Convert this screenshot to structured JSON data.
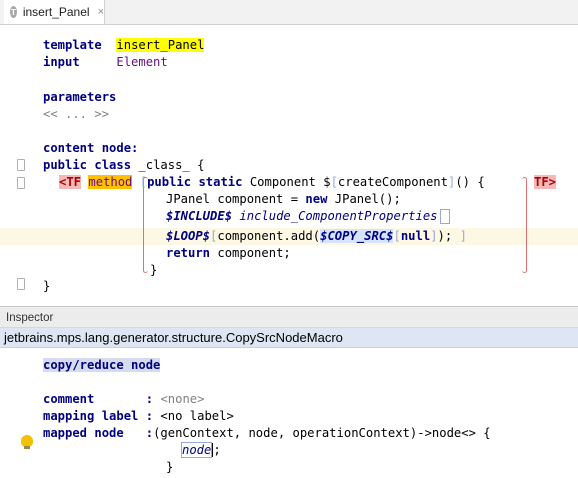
{
  "tab": {
    "icon_letter": "T",
    "title": "insert_Panel",
    "close_glyph": "×"
  },
  "editor": {
    "template_kw": "template",
    "template_name": "insert_Panel",
    "input_kw": "input",
    "input_concept": "Element",
    "parameters_kw": "parameters",
    "parameters_placeholder": "<< ... >>",
    "content_node_kw": "content node:",
    "class_public": "public",
    "class_kw": "class",
    "class_name": "_class_ {",
    "tf_open": "<TF",
    "method_label": "method",
    "method_public": "public",
    "method_static": "static",
    "method_type": "Component",
    "method_dollar": "$",
    "method_name": "createComponent",
    "method_params": "() {",
    "tf_close": "TF>",
    "stmt1_a": "JPanel component = ",
    "stmt1_new": "new",
    "stmt1_b": " JPanel();",
    "include_macro": "$INCLUDE$",
    "include_ref": "include_ComponentProperties",
    "loop_macro": "$LOOP$",
    "loop_a": "component.add(",
    "copy_src_macro": "$COPY_SRC$",
    "loop_null": "null",
    "loop_b": ");",
    "return_kw": "return",
    "return_val": " component;",
    "method_close": "}",
    "class_close": "}"
  },
  "inspector": {
    "header": "Inspector",
    "concept": "jetbrains.mps.lang.generator.structure.CopySrcNodeMacro",
    "macro_title": "copy/reduce node",
    "comment_label": "comment",
    "comment_value": "<none>",
    "mapping_label": "mapping label",
    "mapping_value": "<no label>",
    "mapped_node_label": "mapped node",
    "mapped_node_sig": "(genContext, node, operationContext)->node<> {",
    "mapped_node_body": "node",
    "mapped_node_body_end": ";",
    "mapped_node_close": "}",
    "colon": ":"
  },
  "colors": {
    "keyword": "#000080",
    "concept": "#660e7a",
    "template_highlight": "#ffff00",
    "method_highlight": "#ffc000",
    "tf_tag": "#f5b8b8",
    "inspector_concept_bg": "#dde6f2"
  }
}
